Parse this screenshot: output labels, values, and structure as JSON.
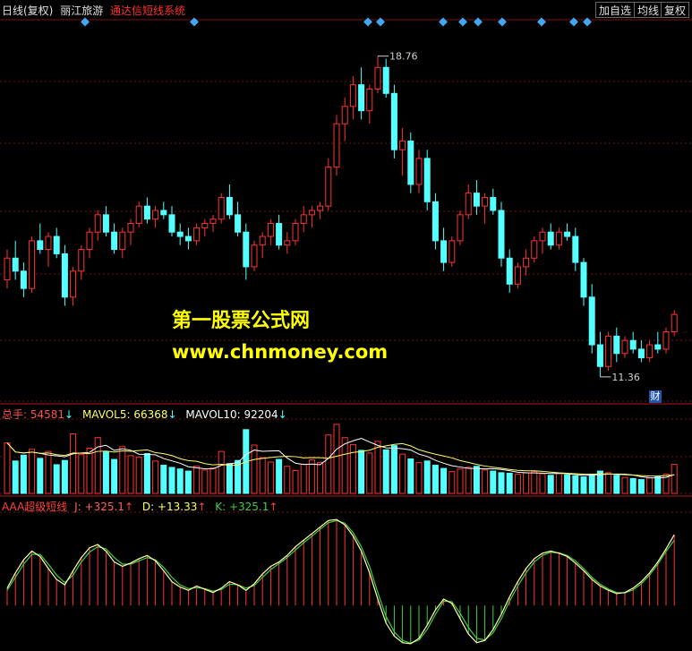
{
  "header": {
    "period": "日线(复权)",
    "stock_name": "丽江旅游",
    "indicator_name": "通达信短线系统",
    "buttons": [
      "加自选",
      "均线",
      "复权"
    ]
  },
  "price_panel": {
    "high_label": "18.76",
    "low_label": "11.36",
    "badge": "财"
  },
  "volume_panel": {
    "label_total": "总手: 54581",
    "label_mavol5": "MAVOL5: 66368",
    "label_mavol10": "MAVOL10: 92204"
  },
  "indicator_panel": {
    "label_name": "AAA超级短线",
    "label_j": "J: +325.1",
    "label_d": "D: +13.33",
    "label_k": "K: +325.1"
  },
  "watermark": {
    "line1": "第一股票公式网",
    "line2": "www.chnmoney.com"
  },
  "colors": {
    "up": "#ff3232",
    "down": "#54ffff",
    "grid": "#7a1010",
    "diamond": "#3fa9f5",
    "ma5": "#ffffff",
    "ma10": "#ffff66",
    "k_line": "#ffffaa",
    "d_line": "#44cc44",
    "watermark": "#ffff00",
    "indicator_title": "#ff4040"
  },
  "chart_data": [
    {
      "type": "candlestick",
      "title": "丽江旅游",
      "ylim": [
        10.8,
        19.6
      ],
      "high": 18.76,
      "low": 11.36,
      "candles": [
        [
          13.6,
          14.3,
          13.4,
          14.1
        ],
        [
          14.1,
          14.5,
          13.6,
          13.8
        ],
        [
          13.8,
          14.0,
          13.2,
          13.4
        ],
        [
          13.4,
          14.6,
          13.3,
          14.5
        ],
        [
          14.5,
          14.9,
          14.2,
          14.3
        ],
        [
          14.3,
          14.7,
          13.9,
          14.6
        ],
        [
          14.6,
          14.8,
          14.1,
          14.2
        ],
        [
          14.2,
          14.4,
          13.0,
          13.2
        ],
        [
          13.2,
          13.9,
          13.0,
          13.8
        ],
        [
          13.8,
          14.4,
          13.6,
          14.3
        ],
        [
          14.3,
          14.8,
          14.1,
          14.7
        ],
        [
          14.7,
          15.2,
          14.5,
          15.1
        ],
        [
          15.1,
          15.3,
          14.6,
          14.7
        ],
        [
          14.7,
          14.9,
          14.2,
          14.3
        ],
        [
          14.3,
          14.8,
          14.1,
          14.7
        ],
        [
          14.7,
          15.0,
          14.4,
          14.9
        ],
        [
          14.9,
          15.4,
          14.8,
          15.3
        ],
        [
          15.3,
          15.5,
          14.9,
          15.0
        ],
        [
          15.0,
          15.3,
          14.8,
          15.2
        ],
        [
          15.2,
          15.4,
          15.0,
          15.1
        ],
        [
          15.1,
          15.3,
          14.6,
          14.7
        ],
        [
          14.7,
          14.9,
          14.4,
          14.6
        ],
        [
          14.6,
          14.8,
          14.3,
          14.5
        ],
        [
          14.5,
          14.9,
          14.4,
          14.8
        ],
        [
          14.8,
          15.0,
          14.6,
          14.9
        ],
        [
          14.9,
          15.1,
          14.7,
          15.0
        ],
        [
          15.0,
          15.6,
          14.9,
          15.5
        ],
        [
          15.5,
          15.8,
          15.0,
          15.1
        ],
        [
          15.1,
          15.4,
          14.6,
          14.7
        ],
        [
          14.7,
          14.9,
          13.6,
          13.9
        ],
        [
          13.9,
          14.5,
          13.8,
          14.4
        ],
        [
          14.4,
          14.7,
          14.1,
          14.6
        ],
        [
          14.6,
          15.0,
          14.4,
          14.9
        ],
        [
          14.9,
          15.1,
          14.3,
          14.4
        ],
        [
          14.4,
          14.7,
          14.2,
          14.5
        ],
        [
          14.5,
          15.0,
          14.4,
          14.9
        ],
        [
          14.9,
          15.3,
          14.7,
          15.1
        ],
        [
          15.1,
          15.3,
          14.8,
          15.2
        ],
        [
          15.2,
          15.4,
          15.0,
          15.3
        ],
        [
          15.3,
          16.4,
          15.2,
          16.2
        ],
        [
          16.2,
          17.4,
          16.0,
          17.2
        ],
        [
          17.2,
          17.8,
          16.8,
          17.6
        ],
        [
          17.6,
          18.3,
          17.3,
          18.1
        ],
        [
          18.1,
          18.5,
          17.3,
          17.5
        ],
        [
          17.5,
          18.1,
          17.2,
          18.0
        ],
        [
          18.0,
          18.76,
          17.9,
          18.5
        ],
        [
          18.5,
          18.7,
          17.8,
          17.9
        ],
        [
          17.9,
          18.1,
          16.4,
          16.6
        ],
        [
          16.6,
          17.1,
          16.0,
          16.8
        ],
        [
          16.8,
          17.0,
          15.6,
          15.8
        ],
        [
          15.8,
          16.6,
          15.6,
          16.4
        ],
        [
          16.4,
          16.6,
          15.2,
          15.4
        ],
        [
          15.4,
          15.6,
          14.3,
          14.5
        ],
        [
          14.5,
          14.8,
          13.8,
          14.0
        ],
        [
          14.0,
          14.6,
          13.9,
          14.5
        ],
        [
          14.5,
          15.2,
          14.4,
          15.1
        ],
        [
          15.1,
          15.8,
          15.0,
          15.6
        ],
        [
          15.6,
          15.9,
          15.1,
          15.3
        ],
        [
          15.3,
          15.6,
          14.9,
          15.5
        ],
        [
          15.5,
          15.7,
          15.1,
          15.2
        ],
        [
          15.2,
          15.4,
          13.9,
          14.1
        ],
        [
          14.1,
          14.3,
          13.3,
          13.5
        ],
        [
          13.5,
          14.0,
          13.4,
          13.9
        ],
        [
          13.9,
          14.3,
          13.7,
          14.1
        ],
        [
          14.1,
          14.6,
          14.0,
          14.5
        ],
        [
          14.5,
          14.8,
          14.2,
          14.7
        ],
        [
          14.7,
          14.9,
          14.3,
          14.4
        ],
        [
          14.4,
          14.8,
          14.3,
          14.7
        ],
        [
          14.7,
          14.9,
          14.5,
          14.6
        ],
        [
          14.6,
          14.8,
          13.8,
          14.0
        ],
        [
          14.0,
          14.1,
          13.0,
          13.2
        ],
        [
          13.2,
          13.5,
          11.9,
          12.1
        ],
        [
          12.1,
          12.4,
          11.36,
          11.6
        ],
        [
          11.6,
          12.4,
          11.5,
          12.3
        ],
        [
          12.3,
          12.5,
          11.7,
          11.9
        ],
        [
          11.9,
          12.3,
          11.8,
          12.2
        ],
        [
          12.2,
          12.4,
          11.9,
          12.0
        ],
        [
          12.0,
          12.2,
          11.7,
          11.8
        ],
        [
          11.8,
          12.2,
          11.7,
          12.1
        ],
        [
          12.1,
          12.4,
          11.9,
          12.0
        ],
        [
          12.0,
          12.5,
          11.9,
          12.4
        ],
        [
          12.4,
          12.9,
          12.3,
          12.8
        ]
      ]
    },
    {
      "type": "bar",
      "title": "总手",
      "series": [
        {
          "name": "总手",
          "values": [
            95000.0,
            61000.0,
            72000.0,
            83000.0,
            66000.0,
            79000.0,
            54000.0,
            62000.0,
            112000.0,
            73000.0,
            85000.0,
            105000.0,
            78000.0,
            64000.0,
            88000.0,
            71000.0,
            68000.0,
            75000.0,
            61000.0,
            53000.0,
            49000.0,
            46000.0,
            42000.0,
            51000.0,
            44000.0,
            48000.0,
            79000.0,
            56000.0,
            62000.0,
            120000.0,
            91000.0,
            67000.0,
            59000.0,
            64000.0,
            51000.0,
            43000.0,
            55000.0,
            63000.0,
            58000.0,
            110000.0,
            130000.0,
            105000.0,
            92000.0,
            81000.0,
            76000.0,
            98000.0,
            82000.0,
            90000.0,
            74000.0,
            65000.0,
            58000.0,
            61000.0,
            53000.0,
            47000.0,
            41000.0,
            46000.0,
            49000.0,
            51000.0,
            44000.0,
            42000.0,
            39000.0,
            38000.0,
            36000.0,
            39000.0,
            41000.0,
            37000.0,
            34000.0,
            38000.0,
            35000.0,
            33000.0,
            31000.0,
            36000.0,
            42000.0,
            39000.0,
            34000.0,
            30000.0,
            28000.0,
            26000.0,
            29000.0,
            32000.0,
            36000.0,
            54600.0
          ]
        },
        {
          "name": "MAVOL5",
          "values": []
        },
        {
          "name": "MAVOL10",
          "values": []
        }
      ]
    },
    {
      "type": "line",
      "title": "AAA超级短线",
      "ylim": [
        -200,
        420
      ],
      "series": [
        {
          "name": "K",
          "values": [
            80,
            150,
            210,
            250,
            225,
            170,
            120,
            95,
            160,
            220,
            265,
            280,
            250,
            200,
            180,
            195,
            215,
            230,
            205,
            160,
            110,
            85,
            70,
            90,
            75,
            60,
            80,
            110,
            95,
            70,
            100,
            145,
            180,
            200,
            230,
            270,
            300,
            330,
            360,
            390,
            395,
            370,
            320,
            250,
            150,
            30,
            -80,
            -140,
            -170,
            -175,
            -150,
            -90,
            -20,
            30,
            10,
            -60,
            -130,
            -170,
            -160,
            -110,
            -40,
            40,
            110,
            170,
            215,
            240,
            250,
            240,
            225,
            195,
            160,
            120,
            90,
            70,
            55,
            60,
            80,
            110,
            150,
            200,
            260,
            325
          ]
        },
        {
          "name": "D",
          "values": [
            70,
            130,
            190,
            235,
            235,
            190,
            140,
            105,
            140,
            200,
            245,
            270,
            260,
            220,
            190,
            190,
            205,
            220,
            210,
            175,
            130,
            95,
            78,
            82,
            78,
            66,
            74,
            98,
            96,
            80,
            92,
            130,
            165,
            192,
            220,
            255,
            288,
            318,
            350,
            380,
            390,
            378,
            335,
            270,
            180,
            60,
            -50,
            -120,
            -160,
            -172,
            -158,
            -110,
            -40,
            20,
            18,
            -35,
            -100,
            -150,
            -158,
            -125,
            -60,
            20,
            90,
            150,
            200,
            230,
            245,
            242,
            230,
            205,
            170,
            130,
            98,
            76,
            60,
            58,
            72,
            100,
            140,
            190,
            248,
            300
          ]
        },
        {
          "name": "J",
          "values": []
        }
      ]
    }
  ]
}
